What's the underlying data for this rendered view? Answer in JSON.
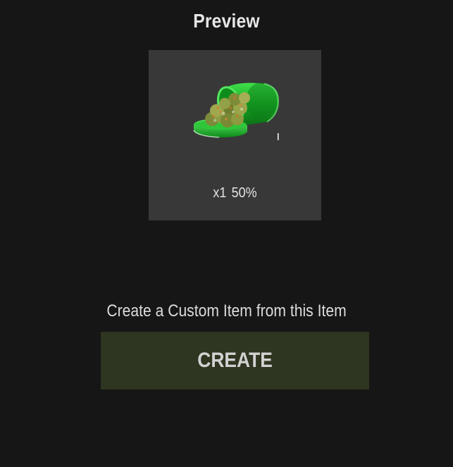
{
  "preview": {
    "title": "Preview",
    "item_icon": "weed-jar-icon",
    "amount": "x1",
    "condition": "50%"
  },
  "custom": {
    "caption": "Create a Custom Item from this Item",
    "button_label": "CREATE"
  },
  "colors": {
    "background": "#161616",
    "card": "#383838",
    "button": "#2e3520",
    "jar_green": "#1fbf2f"
  }
}
